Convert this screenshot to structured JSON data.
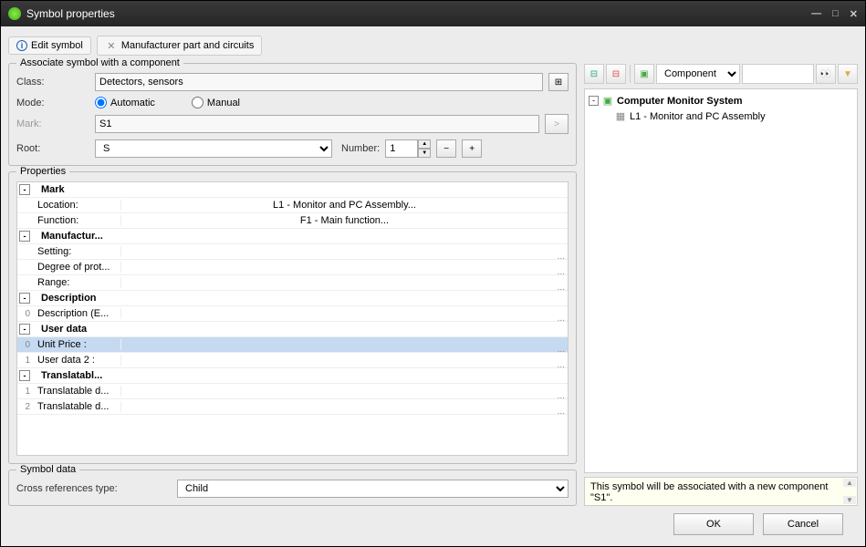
{
  "window": {
    "title": "Symbol properties"
  },
  "toolbar": {
    "edit_symbol": "Edit symbol",
    "mfr_parts": "Manufacturer part and circuits"
  },
  "assoc": {
    "legend": "Associate symbol with a component",
    "class_label": "Class:",
    "class_value": "Detectors, sensors",
    "mode_label": "Mode:",
    "mode_auto": "Automatic",
    "mode_manual": "Manual",
    "mark_label": "Mark:",
    "mark_value": "S1",
    "root_label": "Root:",
    "root_value": "S",
    "number_label": "Number:",
    "number_value": "1"
  },
  "props": {
    "legend": "Properties",
    "groups": {
      "mark": "Mark",
      "manufacturer": "Manufactur...",
      "description": "Description",
      "userdata": "User data",
      "translatable": "Translatabl..."
    },
    "rows": {
      "location_label": "Location:",
      "location_value": "L1 - Monitor and PC Assembly...",
      "function_label": "Function:",
      "function_value": "F1 - Main function...",
      "setting_label": "Setting:",
      "degree_label": "Degree of prot...",
      "range_label": "Range:",
      "desc_en_label": "Description (E...",
      "unit_price_label": "Unit Price :",
      "userdata2_label": "User data 2 :",
      "trans1_label": "Translatable d...",
      "trans2_label": "Translatable d..."
    },
    "idx": {
      "desc_en": "0",
      "unit_price": "0",
      "userdata2": "1",
      "trans1": "1",
      "trans2": "2"
    }
  },
  "symdata": {
    "legend": "Symbol data",
    "crossref_label": "Cross references type:",
    "crossref_value": "Child"
  },
  "right_toolbar": {
    "component_combo": "Component",
    "search_placeholder": ""
  },
  "tree": {
    "root": "Computer Monitor System",
    "child1": "L1 - Monitor and PC Assembly"
  },
  "status": {
    "message": "This symbol will be associated with a new component \"S1\"."
  },
  "buttons": {
    "ok": "OK",
    "cancel": "Cancel"
  },
  "glyphs": {
    "minus": "−",
    "plus": "+",
    "binoc": "🔍",
    "funnel": "▼",
    "tree1": "↕",
    "tree2": "≡",
    "comp": "▣",
    "arrow": ">"
  }
}
